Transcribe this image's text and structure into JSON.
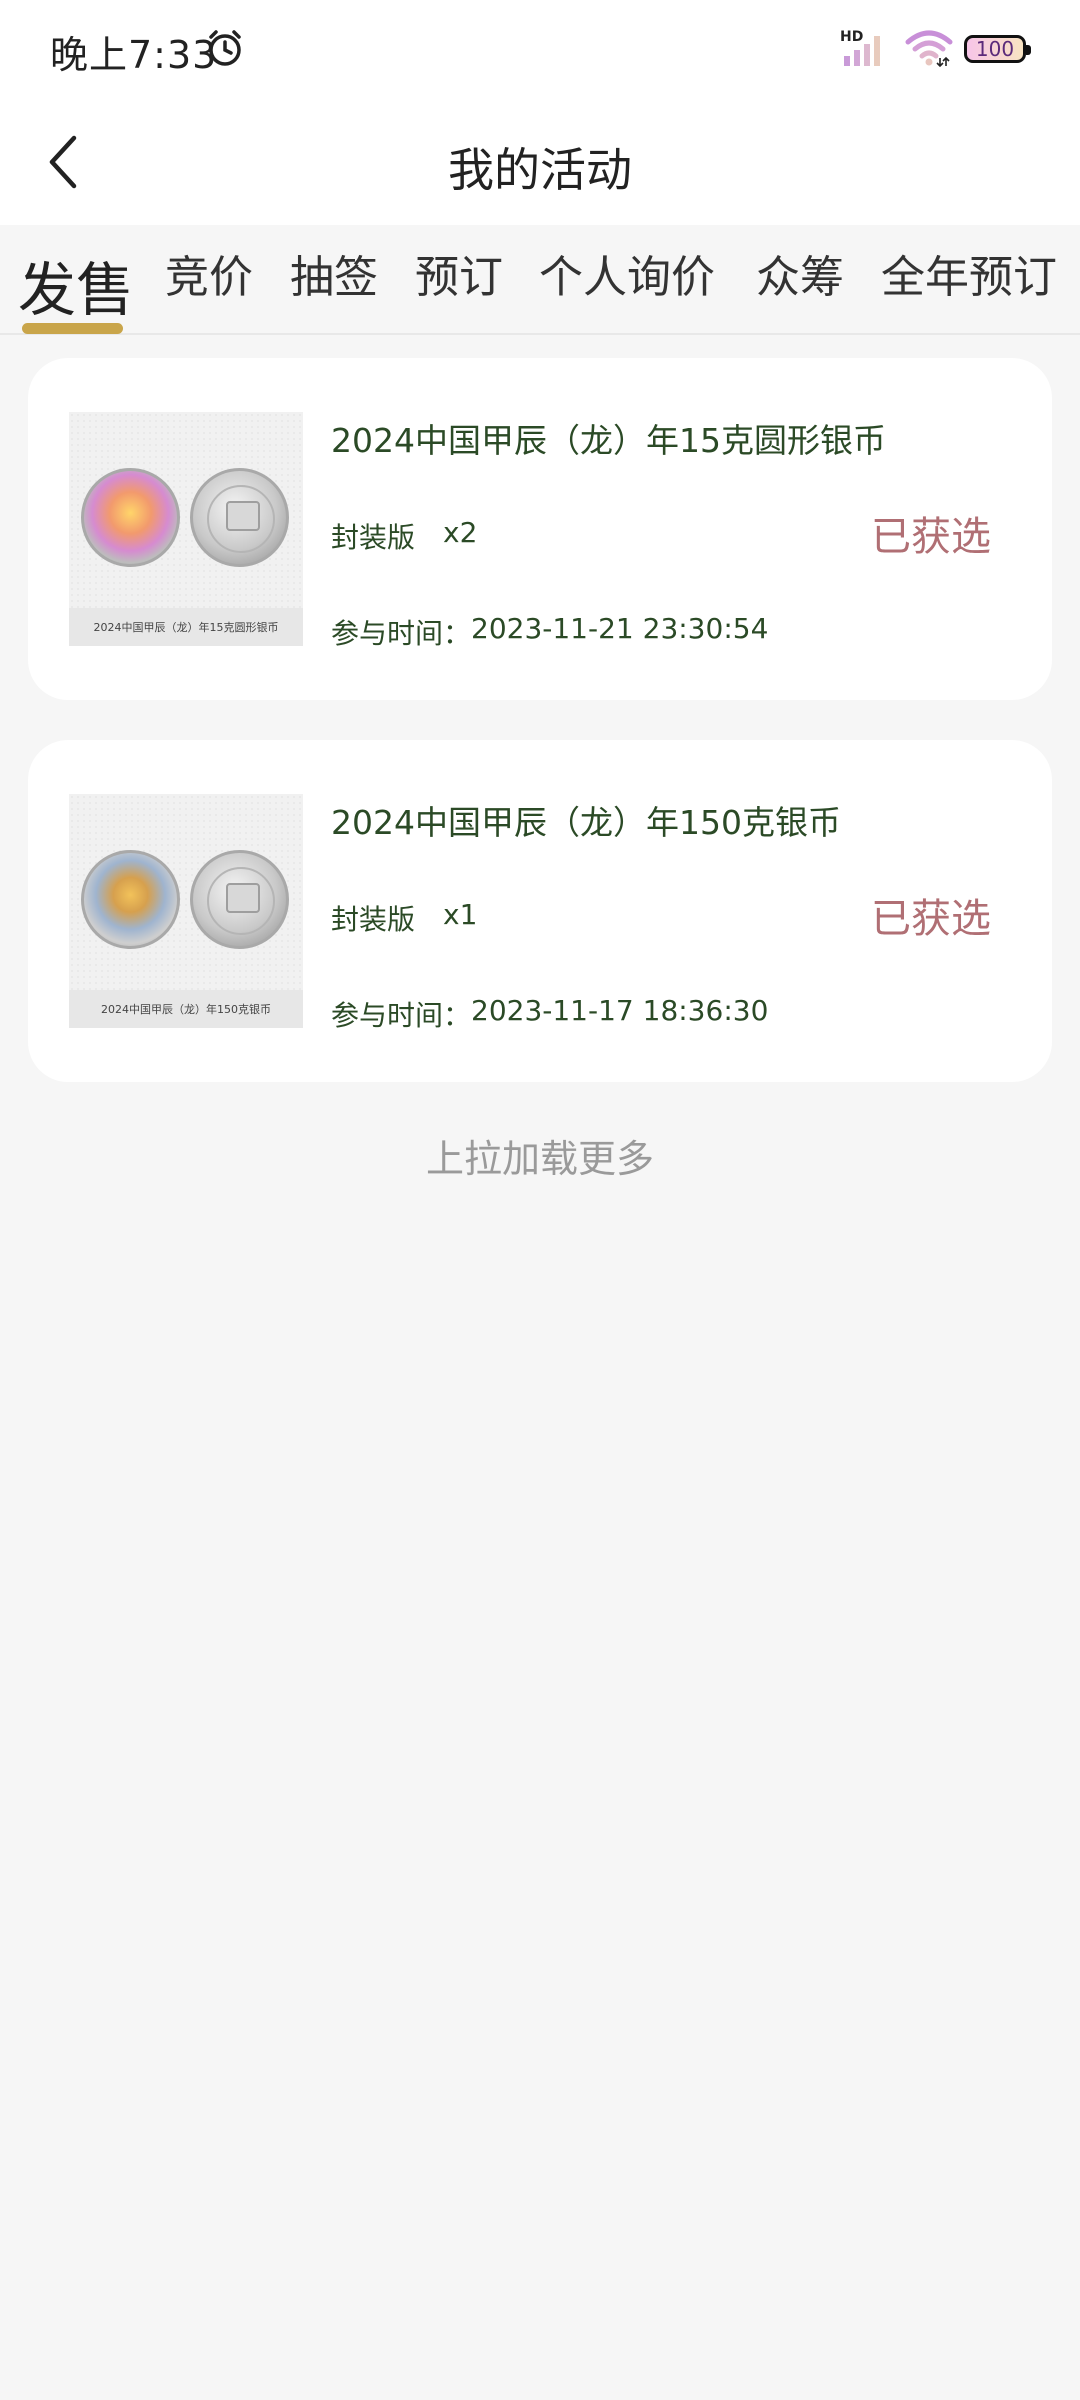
{
  "status_bar": {
    "time": "晚上7:33",
    "network_badge": "HD",
    "battery": "100",
    "icons": [
      "alarm-icon",
      "signal-icon",
      "wifi-icon",
      "battery-icon"
    ]
  },
  "header": {
    "title": "我的活动",
    "back_icon": "chevron-left-icon"
  },
  "tabs": [
    {
      "label": "发售",
      "active": true
    },
    {
      "label": "竞价",
      "active": false
    },
    {
      "label": "抽签",
      "active": false
    },
    {
      "label": "预订",
      "active": false
    },
    {
      "label": "个人询价",
      "active": false
    },
    {
      "label": "众筹",
      "active": false
    },
    {
      "label": "全年预订",
      "active": false
    }
  ],
  "accent_color": "#c9a54a",
  "status_color": "#b06f74",
  "orders": [
    {
      "title": "2024中国甲辰（龙）年15克圆形银币",
      "image_caption": "2024中国甲辰（龙）年15克圆形银币",
      "version": "封装版",
      "quantity": "x2",
      "status": "已获选",
      "time_label": "参与时间：",
      "time": "2023-11-21 23:30:54"
    },
    {
      "title": "2024中国甲辰（龙）年150克银币",
      "image_caption": "2024中国甲辰（龙）年150克银币",
      "version": "封装版",
      "quantity": "x1",
      "status": "已获选",
      "time_label": "参与时间：",
      "time": "2023-11-17 18:36:30"
    }
  ],
  "load_more": "上拉加载更多"
}
